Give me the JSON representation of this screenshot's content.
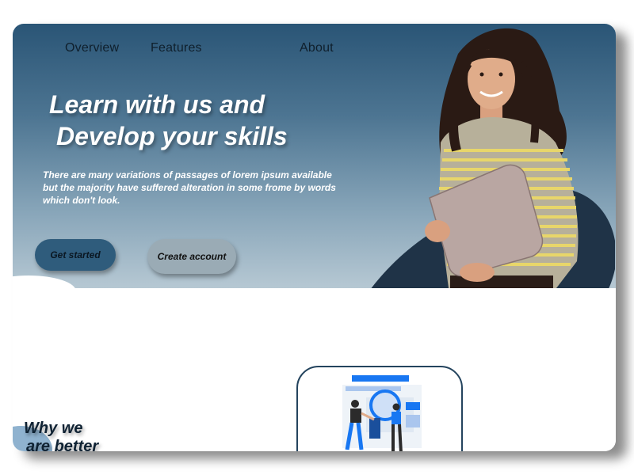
{
  "nav": {
    "items": [
      "Overview",
      "Features",
      "About"
    ]
  },
  "hero": {
    "title_line1": "Learn with us and",
    "title_line2": "Develop your skills",
    "description": "There are many variations of passages of lorem ipsum available but the majority have suffered alteration in some frome by words which don't look.",
    "primary_button": "Get started",
    "secondary_button": "Create account"
  },
  "section": {
    "why_line1": "Why we",
    "why_line2": "are better"
  },
  "colors": {
    "hero_top": "#2a5576",
    "hero_bottom": "#b6c8d3",
    "blob_dark": "#1f3347",
    "accent_blue": "#1877f2",
    "sweater_yellow": "#e8d66a"
  },
  "icons": [
    "person-holding-laptop-illustration",
    "magnifier-illustration"
  ]
}
